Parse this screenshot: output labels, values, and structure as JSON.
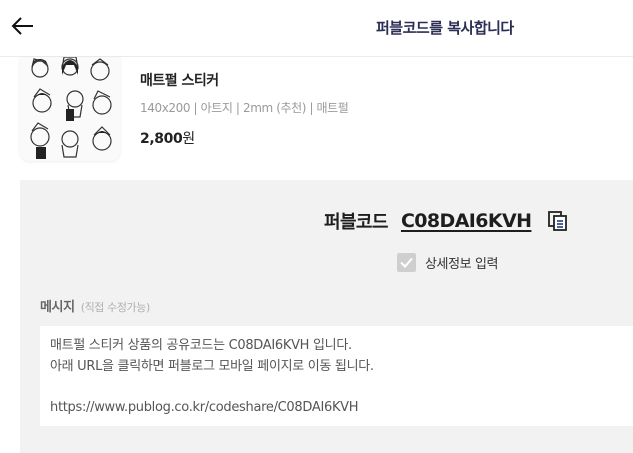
{
  "header": {
    "back_icon": "arrow-left-icon",
    "title": "퍼블코드를 복사합니다"
  },
  "product": {
    "thumbnail_icon": "sticker-collage-image",
    "name": "매트펄 스티커",
    "spec": "140x200 | 아트지 | 2mm (추천) | 매트펄",
    "price_number": "2,800",
    "price_unit": "원"
  },
  "publcode": {
    "label": "퍼블코드",
    "value": "C08DAI6KVH",
    "copy_icon": "copy-icon",
    "accent_color": "#1e3a8a"
  },
  "detail_option": {
    "checked": true,
    "label": "상세정보 입력"
  },
  "message": {
    "title": "메시지",
    "subtitle": "(직접 수정가능)",
    "text": "매트펄 스티커 상품의 공유코드는 C08DAI6KVH 입니다.\n아래 URL을 클릭하면 퍼블로그 모바일 페이지로 이동 됩니다.\n\nhttps://www.publog.co.kr/codeshare/C08DAI6KVH"
  }
}
